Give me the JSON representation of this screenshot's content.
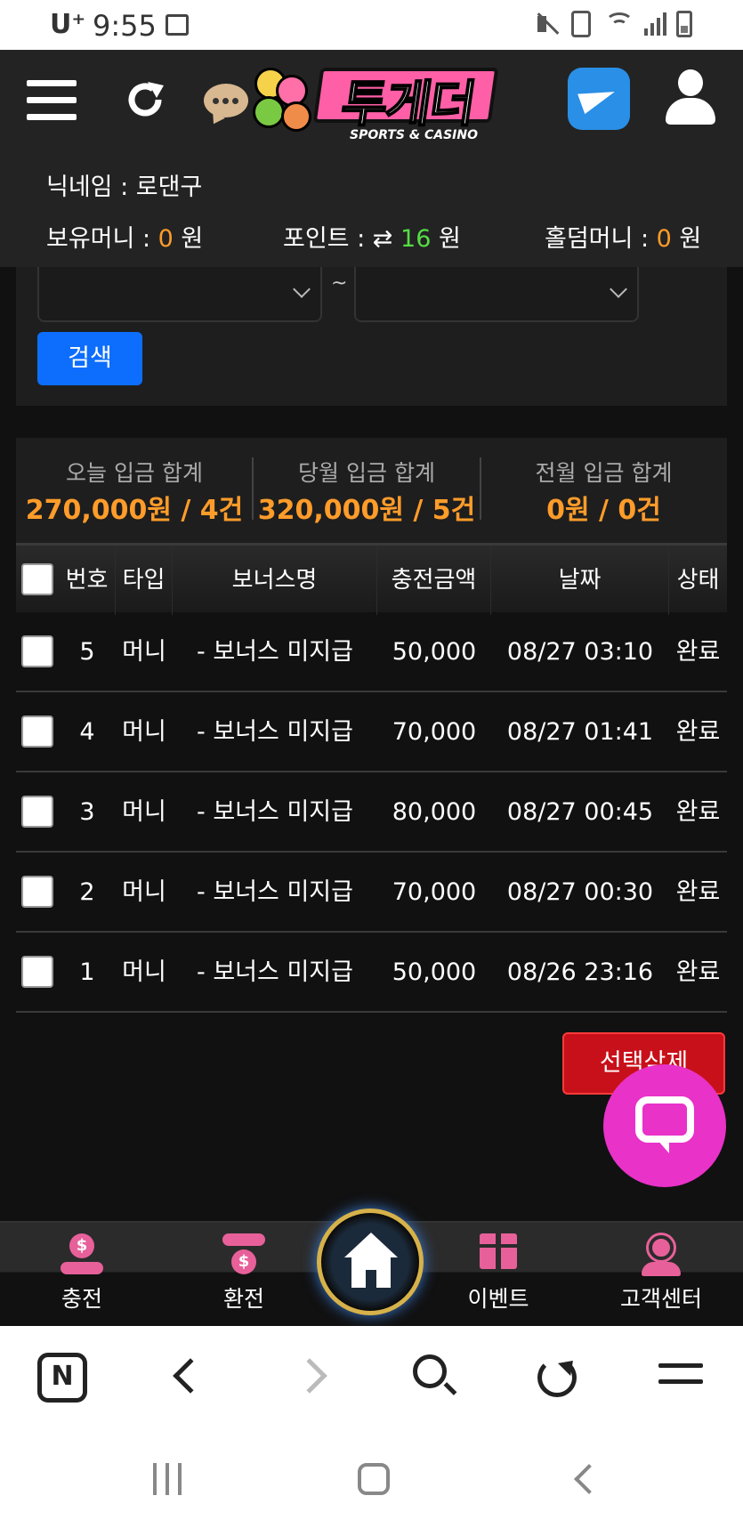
{
  "status_bar": {
    "carrier": "U⁺",
    "time": "9:55"
  },
  "header": {
    "logo_title": "투게더",
    "logo_subtitle": "SPORTS & CASINO",
    "nickname_label": "닉네임 : ",
    "nickname_value": "로댄구",
    "balance_label": "보유머니 : ",
    "balance_value": "0",
    "points_label": "포인트 : ",
    "points_swap": "⇄",
    "points_value": "16",
    "holdem_label": "홀덤머니 : ",
    "holdem_value": "0",
    "currency": "원"
  },
  "filter": {
    "tilde": "~",
    "search_button": "검색"
  },
  "summary": [
    {
      "label": "오늘 입금 합계",
      "value": "270,000원 / 4건"
    },
    {
      "label": "당월 입금 합계",
      "value": "320,000원 / 5건"
    },
    {
      "label": "전월 입금 합계",
      "value": "0원 / 0건"
    }
  ],
  "table": {
    "headers": [
      "번호",
      "타입",
      "보너스명",
      "충전금액",
      "날짜",
      "상태"
    ],
    "rows": [
      {
        "no": "5",
        "type": "머니",
        "bonus": "- 보너스 미지급",
        "amount": "50,000",
        "date": "08/27 03:10",
        "status": "완료"
      },
      {
        "no": "4",
        "type": "머니",
        "bonus": "- 보너스 미지급",
        "amount": "70,000",
        "date": "08/27 01:41",
        "status": "완료"
      },
      {
        "no": "3",
        "type": "머니",
        "bonus": "- 보너스 미지급",
        "amount": "80,000",
        "date": "08/27 00:45",
        "status": "완료"
      },
      {
        "no": "2",
        "type": "머니",
        "bonus": "- 보너스 미지급",
        "amount": "70,000",
        "date": "08/27 00:30",
        "status": "완료"
      },
      {
        "no": "1",
        "type": "머니",
        "bonus": "- 보너스 미지급",
        "amount": "50,000",
        "date": "08/26 23:16",
        "status": "완료"
      }
    ]
  },
  "delete_button": "선택삭제",
  "bottom_nav": {
    "items": [
      "충전",
      "환전",
      "이벤트",
      "고객센터"
    ]
  },
  "colors": {
    "accent_orange": "#ff9c2a",
    "points_green": "#55dd44",
    "search_blue": "#0d6efd",
    "delete_red": "#c8101a",
    "chat_fab_pink": "#e832c8",
    "nav_icon_pink": "#e8609a"
  }
}
